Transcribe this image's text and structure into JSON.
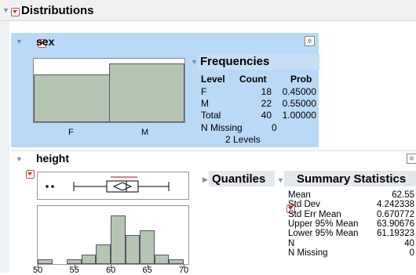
{
  "title": "Distributions",
  "sex": {
    "title": "sex",
    "categories": [
      "F",
      "M"
    ],
    "prob": [
      0.45,
      0.55
    ],
    "freq": {
      "title": "Frequencies",
      "headers": [
        "Level",
        "Count",
        "Prob"
      ],
      "rows": [
        [
          "F",
          "18",
          "0.45000"
        ],
        [
          "M",
          "22",
          "0.55000"
        ],
        [
          "Total",
          "40",
          "1.00000"
        ]
      ],
      "nmissing_label": "N Missing",
      "nmissing_value": "0",
      "levels": "2 Levels"
    }
  },
  "height": {
    "title": "height",
    "quantiles_label": "Quantiles",
    "summary": {
      "title": "Summary Statistics",
      "rows": [
        [
          "Mean",
          "62.55"
        ],
        [
          "Std Dev",
          "4.242338"
        ],
        [
          "Std Err Mean",
          "0.670772"
        ],
        [
          "Upper 95% Mean",
          "63.90676"
        ],
        [
          "Lower 95% Mean",
          "61.19323"
        ],
        [
          "N",
          "40"
        ],
        [
          "N Missing",
          "0"
        ]
      ]
    },
    "axis_ticks": [
      "50",
      "55",
      "60",
      "65",
      "70"
    ]
  },
  "chart_data": [
    {
      "type": "bar",
      "categories": [
        "F",
        "M"
      ],
      "values": [
        0.45,
        0.55
      ]
    },
    {
      "type": "bar",
      "x": [
        51,
        53,
        55,
        57,
        59,
        61,
        63,
        65,
        67,
        69
      ],
      "values": [
        1,
        0,
        1,
        2,
        4,
        10,
        6,
        7,
        2,
        1
      ],
      "xticks": [
        "50",
        "55",
        "60",
        "65",
        "70"
      ]
    }
  ],
  "colors": {
    "selected_panel": "#b9d9f7",
    "panel_bg": "#f4f4f4",
    "bar_fill": "#b5c4b3",
    "accent_red": "#d22"
  }
}
